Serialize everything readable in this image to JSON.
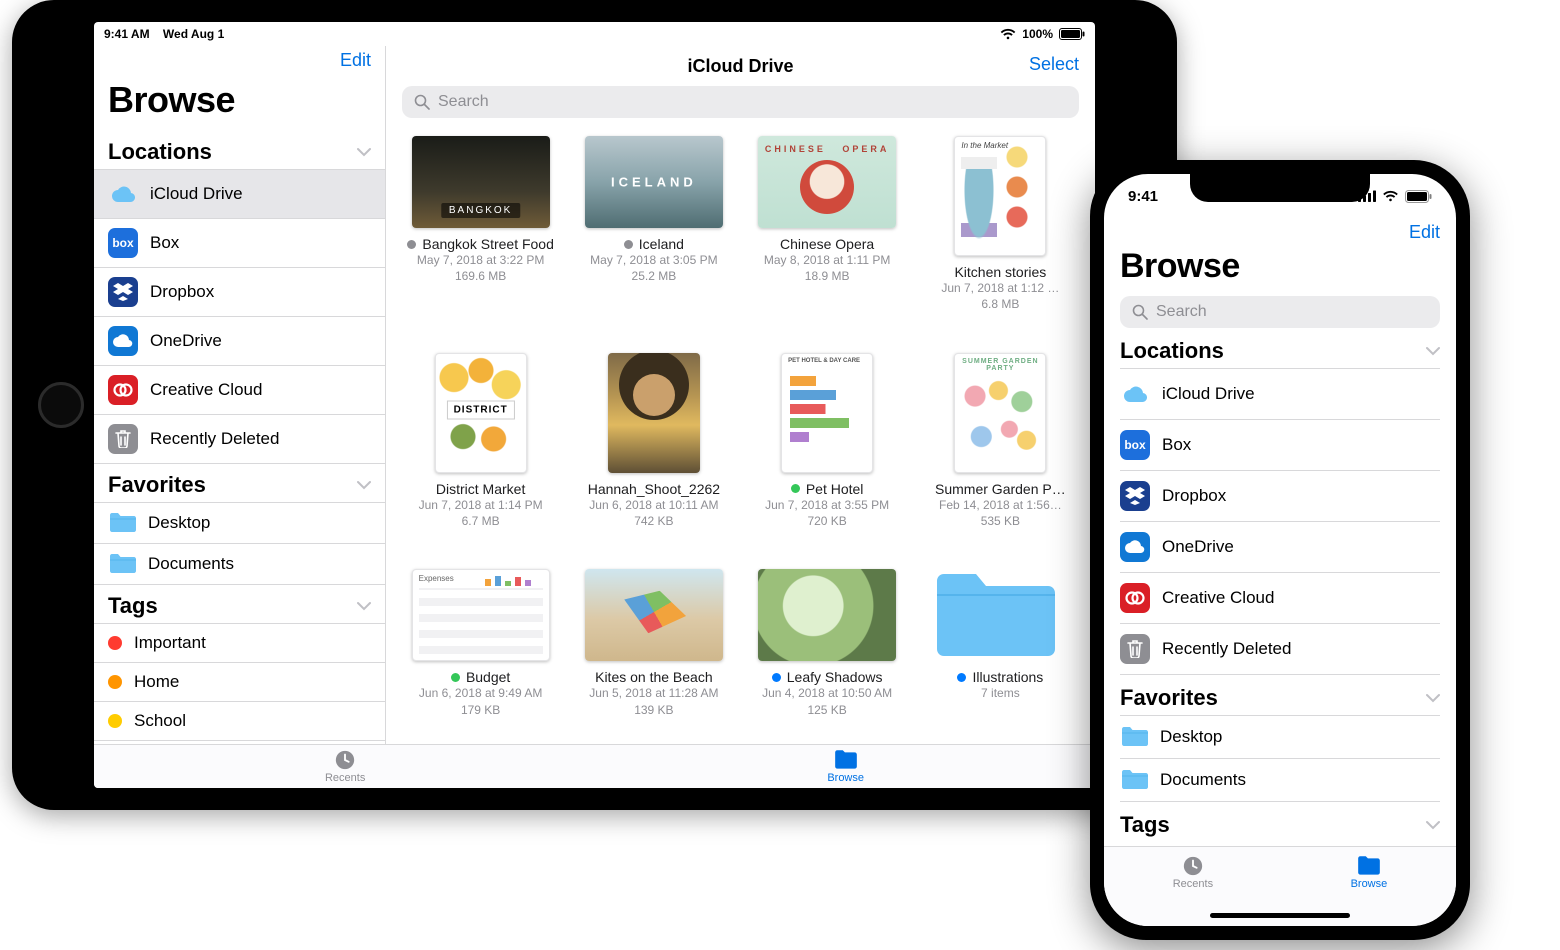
{
  "colors": {
    "link": "#0071e3",
    "tag_red": "#ff3b30",
    "tag_orange": "#ff9500",
    "tag_yellow": "#ffcc00",
    "status_gray": "#8e8e93",
    "status_green": "#34c759",
    "status_blue": "#007aff",
    "folder": "#6cc3f6",
    "icon_box": "#1d6fdc",
    "icon_dropbox": "#1a3f8f",
    "icon_onedrive": "#1078d4",
    "icon_cc": "#da1f26",
    "icon_trash": "#8e8e93"
  },
  "ipad": {
    "status": {
      "time": "9:41 AM",
      "date": "Wed Aug 1",
      "battery": "100%"
    },
    "sidebar": {
      "edit": "Edit",
      "title": "Browse",
      "sections": {
        "locations": {
          "title": "Locations",
          "items": [
            {
              "key": "icloud",
              "label": "iCloud Drive",
              "selected": true,
              "iconColor": "#6cc3f6",
              "icon": "cloud"
            },
            {
              "key": "box",
              "label": "Box",
              "iconColor": "#1d6fdc",
              "icon": "box"
            },
            {
              "key": "dropbox",
              "label": "Dropbox",
              "iconColor": "#1a3f8f",
              "icon": "dropbox"
            },
            {
              "key": "onedrive",
              "label": "OneDrive",
              "iconColor": "#1078d4",
              "icon": "onedrive"
            },
            {
              "key": "cc",
              "label": "Creative Cloud",
              "iconColor": "#da1f26",
              "icon": "cc"
            },
            {
              "key": "trash",
              "label": "Recently Deleted",
              "iconColor": "#8e8e93",
              "icon": "trash"
            }
          ]
        },
        "favorites": {
          "title": "Favorites",
          "items": [
            {
              "key": "desktop",
              "label": "Desktop"
            },
            {
              "key": "documents",
              "label": "Documents"
            }
          ]
        },
        "tags": {
          "title": "Tags",
          "items": [
            {
              "key": "important",
              "label": "Important",
              "color": "#ff3b30"
            },
            {
              "key": "home",
              "label": "Home",
              "color": "#ff9500"
            },
            {
              "key": "school",
              "label": "School",
              "color": "#ffcc00"
            }
          ]
        }
      }
    },
    "main": {
      "title": "iCloud Drive",
      "select": "Select",
      "search_placeholder": "Search",
      "files": [
        {
          "key": "bangkok",
          "name": "Bangkok Street Food",
          "meta": "May 7, 2018 at 3:22 PM",
          "size": "169.6 MB",
          "status": "gray",
          "thumb": "t-bangkok",
          "shape": "land"
        },
        {
          "key": "iceland",
          "name": "Iceland",
          "meta": "May 7, 2018 at 3:05 PM",
          "size": "25.2 MB",
          "status": "gray",
          "thumb": "t-iceland",
          "shape": "land"
        },
        {
          "key": "opera",
          "name": "Chinese Opera",
          "meta": "May 8, 2018 at 1:11 PM",
          "size": "18.9 MB",
          "status": "",
          "thumb": "t-opera",
          "shape": "land"
        },
        {
          "key": "kitchen",
          "name": "Kitchen stories",
          "meta": "Jun 7, 2018 at 1:12 …",
          "size": "6.8 MB",
          "status": "",
          "thumb": "t-kitchen",
          "shape": "portrait"
        },
        {
          "key": "district",
          "name": "District Market",
          "meta": "Jun 7, 2018 at 1:14 PM",
          "size": "6.7 MB",
          "status": "",
          "thumb": "t-district",
          "shape": "portrait"
        },
        {
          "key": "hannah",
          "name": "Hannah_Shoot_2262",
          "meta": "Jun 6, 2018 at 10:11 AM",
          "size": "742 KB",
          "status": "",
          "thumb": "t-hannah",
          "shape": "portrait"
        },
        {
          "key": "pethotel",
          "name": "Pet Hotel",
          "meta": "Jun 7, 2018 at 3:55 PM",
          "size": "720 KB",
          "status": "green",
          "thumb": "t-pethotel",
          "shape": "portrait"
        },
        {
          "key": "summer",
          "name": "Summer Garden P…",
          "meta": "Feb 14, 2018 at 1:56…",
          "size": "535 KB",
          "status": "",
          "thumb": "t-summer",
          "shape": "portrait"
        },
        {
          "key": "budget",
          "name": "Budget",
          "meta": "Jun 6, 2018 at 9:49 AM",
          "size": "179 KB",
          "status": "green",
          "thumb": "t-budget",
          "shape": "land"
        },
        {
          "key": "kites",
          "name": "Kites on the Beach",
          "meta": "Jun 5, 2018 at 11:28 AM",
          "size": "139 KB",
          "status": "",
          "thumb": "t-kites",
          "shape": "land"
        },
        {
          "key": "leafy",
          "name": "Leafy Shadows",
          "meta": "Jun 4, 2018 at 10:50 AM",
          "size": "125 KB",
          "status": "blue",
          "thumb": "t-leafy",
          "shape": "land"
        },
        {
          "key": "illustrations",
          "name": "Illustrations",
          "meta": "7 items",
          "size": "",
          "status": "blue",
          "thumb": "folder",
          "shape": "folder"
        }
      ]
    },
    "tabbar": {
      "recents": "Recents",
      "browse": "Browse"
    }
  },
  "phone": {
    "status": {
      "time": "9:41"
    },
    "edit": "Edit",
    "title": "Browse",
    "search_placeholder": "Search",
    "sections": {
      "locations": {
        "title": "Locations",
        "items": [
          {
            "key": "icloud",
            "label": "iCloud Drive",
            "iconColor": "#6cc3f6",
            "icon": "cloud"
          },
          {
            "key": "box",
            "label": "Box",
            "iconColor": "#1d6fdc",
            "icon": "box"
          },
          {
            "key": "dropbox",
            "label": "Dropbox",
            "iconColor": "#1a3f8f",
            "icon": "dropbox"
          },
          {
            "key": "onedrive",
            "label": "OneDrive",
            "iconColor": "#1078d4",
            "icon": "onedrive"
          },
          {
            "key": "cc",
            "label": "Creative Cloud",
            "iconColor": "#da1f26",
            "icon": "cc"
          },
          {
            "key": "trash",
            "label": "Recently Deleted",
            "iconColor": "#8e8e93",
            "icon": "trash"
          }
        ]
      },
      "favorites": {
        "title": "Favorites",
        "items": [
          {
            "key": "desktop",
            "label": "Desktop"
          },
          {
            "key": "documents",
            "label": "Documents"
          }
        ]
      },
      "tags": {
        "title": "Tags"
      }
    },
    "tabbar": {
      "recents": "Recents",
      "browse": "Browse"
    }
  }
}
